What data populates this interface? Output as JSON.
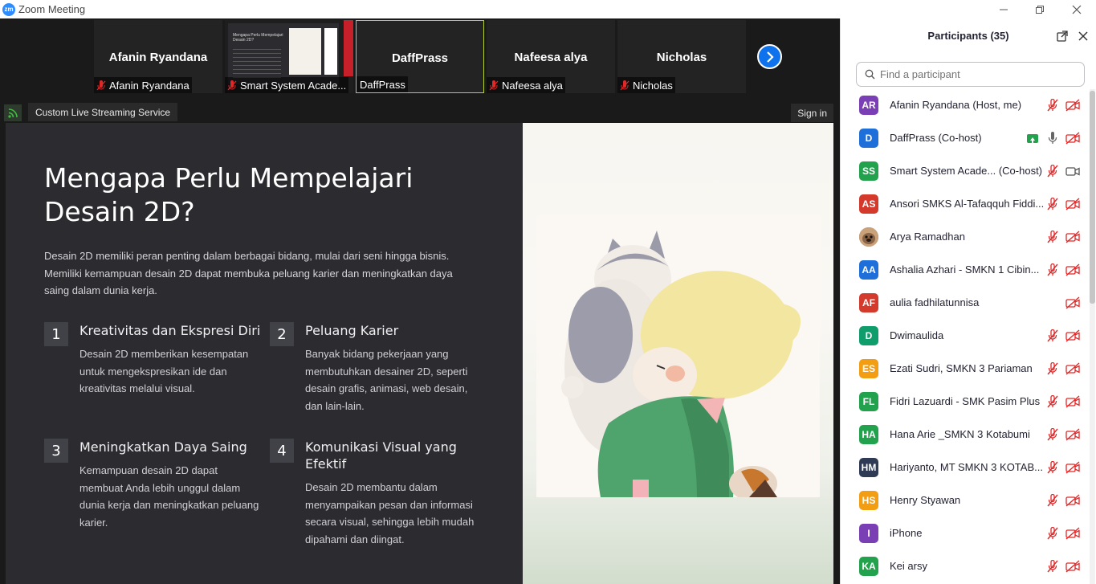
{
  "window": {
    "title": "Zoom Meeting",
    "logo": "zm"
  },
  "gallery": {
    "tiles": [
      {
        "big_name": "Afanin Ryandana",
        "label": "Afanin Ryandana",
        "muted": true
      },
      {
        "big_name": "",
        "label": "Smart System Acade...",
        "muted": true
      },
      {
        "big_name": "DaffPrass",
        "label": "DaffPrass",
        "muted": false
      },
      {
        "big_name": "Nafeesa alya",
        "label": "Nafeesa alya",
        "muted": true
      },
      {
        "big_name": "Nicholas",
        "label": "Nicholas",
        "muted": true
      }
    ],
    "thumb_title": "Mengapa Perlu Mempelajari Desain 2D?"
  },
  "livebar": {
    "stream_label": "Custom Live Streaming Service",
    "signin_label": "Sign in"
  },
  "slide": {
    "title": "Mengapa Perlu Mempelajari Desain 2D?",
    "intro": "Desain 2D memiliki peran penting dalam berbagai bidang, mulai dari seni hingga bisnis. Memiliki kemampuan desain 2D dapat membuka peluang karier dan meningkatkan daya saing dalam dunia kerja.",
    "points": [
      {
        "num": "1",
        "heading": "Kreativitas dan Ekspresi Diri",
        "desc": "Desain 2D memberikan kesempatan untuk mengekspresikan ide dan kreativitas melalui visual."
      },
      {
        "num": "2",
        "heading": "Peluang Karier",
        "desc": "Banyak bidang pekerjaan yang membutuhkan desainer 2D, seperti desain grafis, animasi, web desain, dan lain-lain."
      },
      {
        "num": "3",
        "heading": "Meningkatkan Daya Saing",
        "desc": "Kemampuan desain 2D dapat membuat Anda lebih unggul dalam dunia kerja dan meningkatkan peluang karier."
      },
      {
        "num": "4",
        "heading": "Komunikasi Visual yang Efektif",
        "desc": "Desain 2D membantu dalam menyampaikan pesan dan informasi secara visual, sehingga lebih mudah dipahami dan diingat."
      }
    ]
  },
  "participants": {
    "title": "Participants (35)",
    "search_placeholder": "Find a participant",
    "list": [
      {
        "initials": "AR",
        "color": "#7b3fb5",
        "name": "Afanin Ryandana (Host, me)",
        "mic": "muted",
        "video": "off",
        "share": false
      },
      {
        "initials": "D",
        "color": "#1e6fd9",
        "name": "DaffPrass (Co-host)",
        "mic": "on",
        "video": "off",
        "share": true
      },
      {
        "initials": "SS",
        "color": "#23a24d",
        "name": "Smart System Acade...  (Co-host)",
        "mic": "muted",
        "video": "on",
        "share": false
      },
      {
        "initials": "AS",
        "color": "#d33a2c",
        "name": "Ansori SMKS Al-Tafaqquh Fiddi...",
        "mic": "muted",
        "video": "off",
        "share": false
      },
      {
        "initials": "",
        "color": "#6b4a35",
        "name": "Arya Ramadhan",
        "mic": "muted",
        "video": "off",
        "share": false,
        "photo": true
      },
      {
        "initials": "AA",
        "color": "#1e6fd9",
        "name": "Ashalia Azhari - SMKN 1 Cibin...",
        "mic": "muted",
        "video": "off",
        "share": false
      },
      {
        "initials": "AF",
        "color": "#d33a2c",
        "name": "aulia fadhilatunnisa",
        "mic": "none",
        "video": "off",
        "share": false
      },
      {
        "initials": "D",
        "color": "#0f9d6b",
        "name": "Dwimaulida",
        "mic": "muted",
        "video": "off",
        "share": false
      },
      {
        "initials": "ES",
        "color": "#f29d12",
        "name": "Ezati Sudri, SMKN 3 Pariaman",
        "mic": "muted",
        "video": "off",
        "share": false
      },
      {
        "initials": "FL",
        "color": "#23a24d",
        "name": "Fidri Lazuardi - SMK Pasim Plus",
        "mic": "muted",
        "video": "off",
        "share": false
      },
      {
        "initials": "HA",
        "color": "#23a24d",
        "name": "Hana Arie _SMKN 3 Kotabumi",
        "mic": "muted",
        "video": "off",
        "share": false
      },
      {
        "initials": "HM",
        "color": "#2f3a55",
        "name": "Hariyanto, MT SMKN 3 KOTAB...",
        "mic": "muted",
        "video": "off",
        "share": false
      },
      {
        "initials": "HS",
        "color": "#f29d12",
        "name": "Henry Styawan",
        "mic": "muted",
        "video": "off",
        "share": false
      },
      {
        "initials": "I",
        "color": "#7b3fb5",
        "name": "iPhone",
        "mic": "muted",
        "video": "off",
        "share": false
      },
      {
        "initials": "KA",
        "color": "#23a24d",
        "name": "Kei arsy",
        "mic": "muted",
        "video": "off",
        "share": false
      }
    ]
  },
  "colors": {
    "accent": "#0e72ed",
    "muted_red": "#e02828",
    "active_border": "#b5d12f"
  }
}
